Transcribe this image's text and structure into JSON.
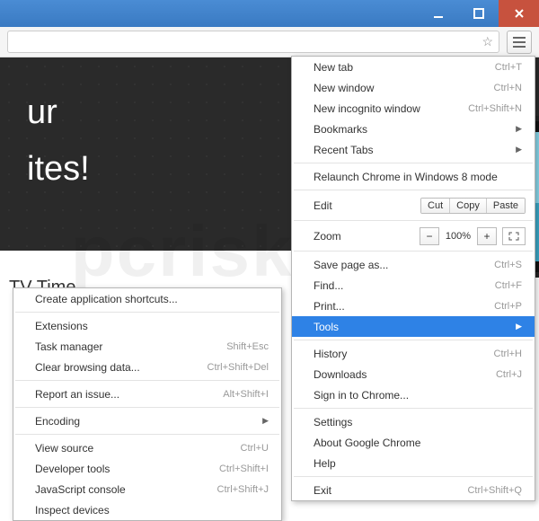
{
  "page": {
    "hero_line1": "ur",
    "hero_line2": "ites!",
    "caption": "TV Time"
  },
  "watermark": "pcrisk.com",
  "main_menu": {
    "new_tab": {
      "label": "New tab",
      "shortcut": "Ctrl+T"
    },
    "new_window": {
      "label": "New window",
      "shortcut": "Ctrl+N"
    },
    "new_incognito": {
      "label": "New incognito window",
      "shortcut": "Ctrl+Shift+N"
    },
    "bookmarks": {
      "label": "Bookmarks"
    },
    "recent_tabs": {
      "label": "Recent Tabs"
    },
    "relaunch": {
      "label": "Relaunch Chrome in Windows 8 mode"
    },
    "edit": {
      "label": "Edit",
      "cut": "Cut",
      "copy": "Copy",
      "paste": "Paste"
    },
    "zoom": {
      "label": "Zoom",
      "value": "100%"
    },
    "save_as": {
      "label": "Save page as...",
      "shortcut": "Ctrl+S"
    },
    "find": {
      "label": "Find...",
      "shortcut": "Ctrl+F"
    },
    "print": {
      "label": "Print...",
      "shortcut": "Ctrl+P"
    },
    "tools": {
      "label": "Tools"
    },
    "history": {
      "label": "History",
      "shortcut": "Ctrl+H"
    },
    "downloads": {
      "label": "Downloads",
      "shortcut": "Ctrl+J"
    },
    "signin": {
      "label": "Sign in to Chrome..."
    },
    "settings": {
      "label": "Settings"
    },
    "about": {
      "label": "About Google Chrome"
    },
    "help": {
      "label": "Help"
    },
    "exit": {
      "label": "Exit",
      "shortcut": "Ctrl+Shift+Q"
    }
  },
  "tools_menu": {
    "create_shortcuts": {
      "label": "Create application shortcuts..."
    },
    "extensions": {
      "label": "Extensions"
    },
    "task_manager": {
      "label": "Task manager",
      "shortcut": "Shift+Esc"
    },
    "clear_data": {
      "label": "Clear browsing data...",
      "shortcut": "Ctrl+Shift+Del"
    },
    "report_issue": {
      "label": "Report an issue...",
      "shortcut": "Alt+Shift+I"
    },
    "encoding": {
      "label": "Encoding"
    },
    "view_source": {
      "label": "View source",
      "shortcut": "Ctrl+U"
    },
    "dev_tools": {
      "label": "Developer tools",
      "shortcut": "Ctrl+Shift+I"
    },
    "js_console": {
      "label": "JavaScript console",
      "shortcut": "Ctrl+Shift+J"
    },
    "inspect_devices": {
      "label": "Inspect devices"
    }
  }
}
